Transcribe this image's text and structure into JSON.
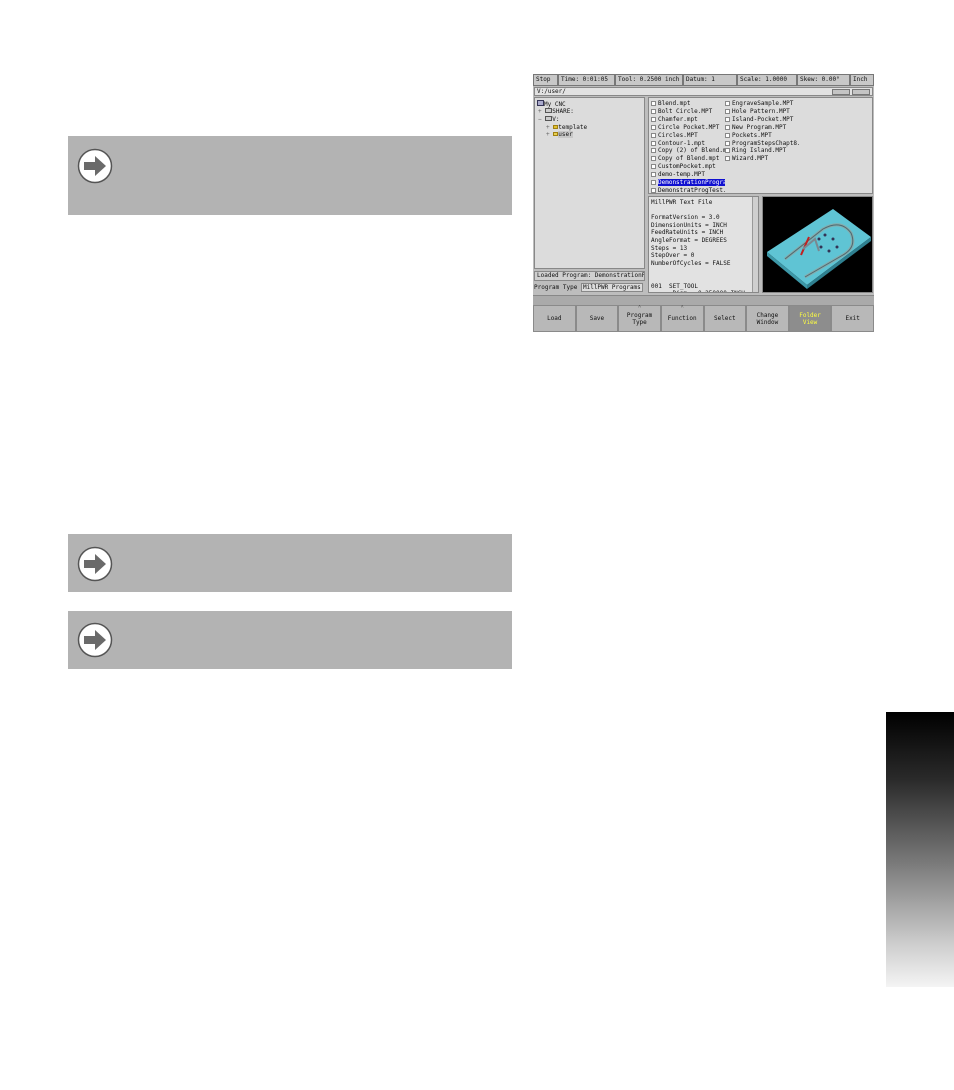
{
  "status": {
    "mode": "Stop",
    "time": "Time: 0:01:05",
    "tool": "Tool: 0.2500 inch",
    "datum": "Datum: 1",
    "scale": "Scale: 1.0000",
    "skew": "Skew: 0.00°",
    "units": "Inch"
  },
  "path": "V:/user/",
  "tree": [
    {
      "label": "My CNC",
      "icon": "computer-icon"
    },
    {
      "label": "SHARE:",
      "icon": "network-drive-icon"
    },
    {
      "label": "V:",
      "icon": "drive-icon"
    },
    {
      "label": "template",
      "icon": "folder-icon"
    },
    {
      "label": "user",
      "icon": "folder-open-icon"
    }
  ],
  "files_left": [
    "Blend.mpt",
    "Bolt Circle.MPT",
    "Chamfer.mpt",
    "Circle Pocket.MPT",
    "Circles.MPT",
    "Contour-1.mpt",
    "Copy (2) of Blend.m...",
    "Copy of Blend.mpt",
    "CustomPocket.mpt",
    "demo-temp.MPT",
    "DemonstrationProgra...",
    "DemonstratProgTest..."
  ],
  "files_right": [
    "EngraveSample.MPT",
    "Hole Pattern.MPT",
    "Island-Pocket.MPT",
    "New Program.MPT",
    "Pockets.MPT",
    "ProgramStepsChapt8...",
    "Ring Island.MPT",
    "Wizard.MPT"
  ],
  "selected_file": "DemonstrationProgra...",
  "text_lines": [
    "MillPWR Text File",
    "",
    "FormatVersion = 3.0",
    "DimensionUnits = INCH",
    "FeedRateUnits = INCH",
    "AngleFormat = DEGREES",
    "Steps = 13",
    "StepOver = 0",
    "NumberOfCycles = FALSE",
    "",
    "",
    "001  SET_TOOL",
    "      Diam = 0.250000 INCH"
  ],
  "loaded_program": "Loaded Program: DemonstrationP...",
  "program_type_label": "Program Type",
  "program_type_value": "MillPWR Programs",
  "softkeys": {
    "load": "Load",
    "save": "Save",
    "program_type": "Program\nType",
    "function": "Function",
    "select": "Select",
    "change_window": "Change\nWindow",
    "folder_view": "Folder\nView",
    "exit": "Exit"
  },
  "colors": {
    "note_bg": "#b3b3b3",
    "selection": "#1010d0",
    "active_key_text": "#ffff40",
    "preview_part": "#5fc4d4"
  }
}
